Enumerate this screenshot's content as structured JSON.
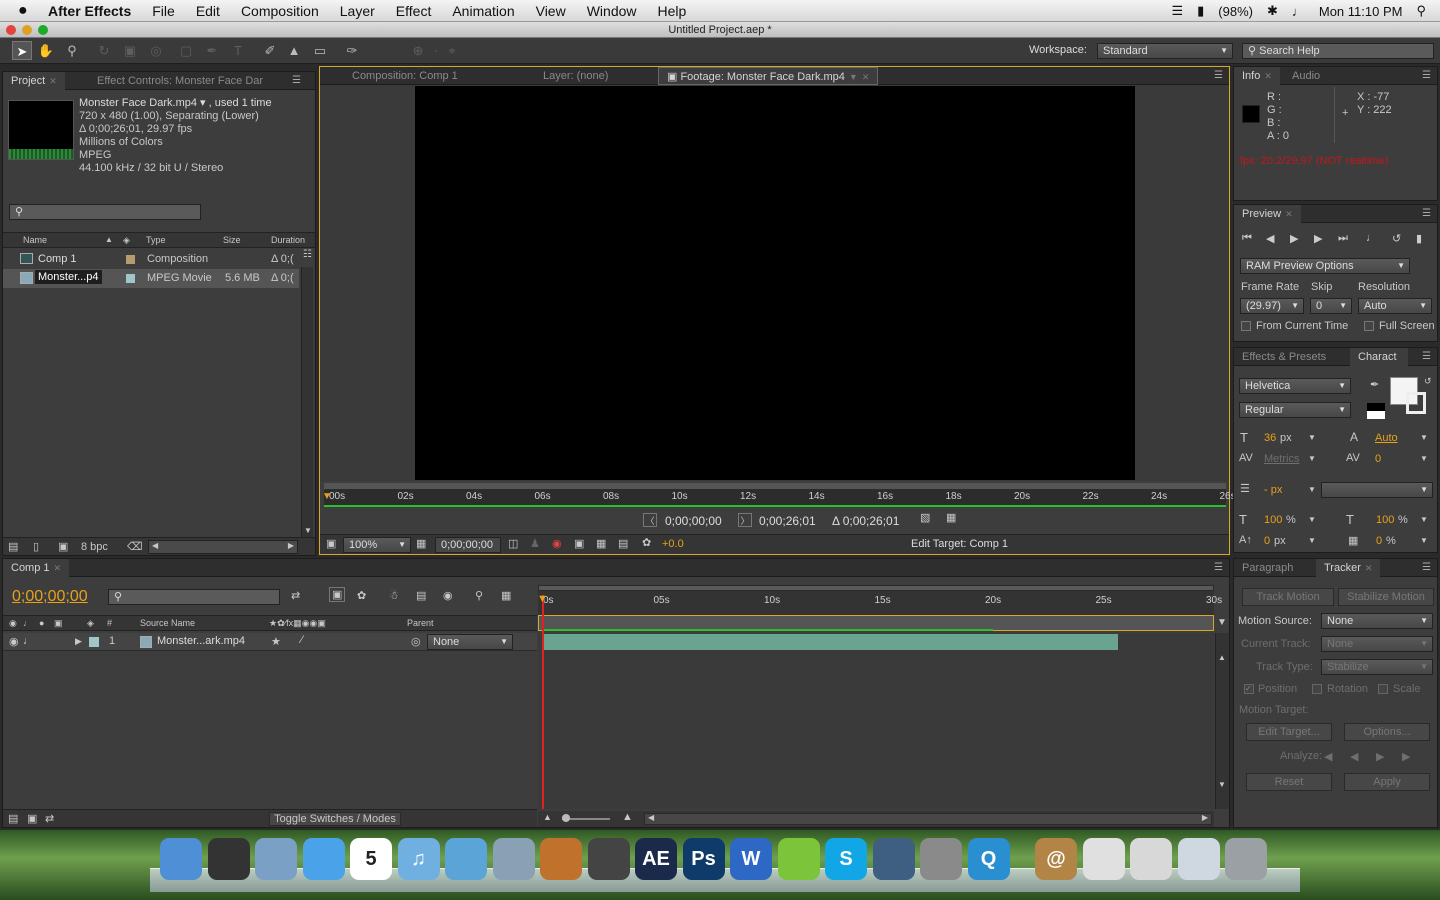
{
  "menubar": {
    "app": "After Effects",
    "items": [
      "File",
      "Edit",
      "Composition",
      "Layer",
      "Effect",
      "Animation",
      "View",
      "Window",
      "Help"
    ],
    "battery": "(98%)",
    "clock": "Mon 11:10 PM"
  },
  "window": {
    "title": "Untitled Project.aep *"
  },
  "toolbar": {
    "workspace_label": "Workspace:",
    "workspace_value": "Standard",
    "search_placeholder": "Search Help"
  },
  "project": {
    "tabs": [
      {
        "label": "Project"
      },
      {
        "label": "Effect Controls: Monster Face Dar"
      }
    ],
    "footage": {
      "name": "Monster Face Dark.mp4 ▾ , used 1 time",
      "line1": "720 x 480 (1.00), Separating (Lower)",
      "line2": "Δ 0;00;26;01, 29.97 fps",
      "line3": "Millions of Colors",
      "line4": "MPEG",
      "line5": "44.100 kHz / 32 bit U / Stereo"
    },
    "columns": {
      "name": "Name",
      "type": "Type",
      "size": "Size",
      "duration": "Duration"
    },
    "rows": [
      {
        "name": "Comp 1",
        "type": "Composition",
        "size": "",
        "duration": "Δ 0;(",
        "color": "#b59b6d"
      },
      {
        "name": "Monster...p4",
        "type": "MPEG Movie",
        "size": "5.6 MB",
        "duration": "Δ 0;(",
        "color": "#9fc7c7"
      }
    ],
    "bpc": "8 bpc"
  },
  "viewer": {
    "tabs": [
      {
        "label": "Composition: Comp 1"
      },
      {
        "label": "Layer: (none)"
      },
      {
        "label": "Footage: Monster Face Dark.mp4"
      }
    ],
    "ruler": [
      "00s",
      "02s",
      "04s",
      "06s",
      "08s",
      "10s",
      "12s",
      "14s",
      "16s",
      "18s",
      "20s",
      "22s",
      "24s",
      "26s"
    ],
    "in_time": "0;00;00;00",
    "out_time": "0;00;26;01",
    "duration_time": "Δ 0;00;26;01",
    "zoom": "100%",
    "current_time": "0;00;00;00",
    "offset": "+0.0",
    "edit_target": "Edit Target: Comp 1"
  },
  "info": {
    "tabs": [
      {
        "label": "Info"
      },
      {
        "label": "Audio"
      }
    ],
    "r": "R :",
    "g": "G :",
    "b": "B :",
    "a": "A : 0",
    "x": "X : -77",
    "y": "Y : 222",
    "fps": "fps: 20.2/29.97 (NOT realtime)"
  },
  "preview": {
    "tab": "Preview",
    "ram_options": "RAM Preview Options",
    "frame_rate_label": "Frame Rate",
    "skip_label": "Skip",
    "resolution_label": "Resolution",
    "frame_rate": "(29.97)",
    "skip": "0",
    "resolution": "Auto",
    "from_current": "From Current Time",
    "full_screen": "Full Screen"
  },
  "character": {
    "tabs": [
      {
        "label": "Effects & Presets"
      },
      {
        "label": "Charact"
      }
    ],
    "font": "Helvetica",
    "style": "Regular",
    "size": "36",
    "size_unit": "px",
    "leading": "Auto",
    "kerning": "Metrics",
    "tracking": "0",
    "stroke": "- px",
    "vscale": "100",
    "hscale": "100",
    "pct": "%",
    "baseline": "0",
    "baseline_unit": "px",
    "tsume": "0",
    "tsume_unit": "%"
  },
  "tracker": {
    "tabs": [
      {
        "label": "Paragraph"
      },
      {
        "label": "Tracker"
      }
    ],
    "track_motion": "Track Motion",
    "stabilize_motion": "Stabilize Motion",
    "motion_source_label": "Motion Source:",
    "motion_source": "None",
    "current_track_label": "Current Track:",
    "current_track": "None",
    "track_type_label": "Track Type:",
    "track_type": "Stabilize",
    "position": "Position",
    "rotation": "Rotation",
    "scale": "Scale",
    "motion_target_label": "Motion Target:",
    "edit_target": "Edit Target...",
    "options": "Options...",
    "analyze_label": "Analyze:",
    "reset": "Reset",
    "apply": "Apply"
  },
  "timeline": {
    "tab": "Comp 1",
    "current_time": "0;00;00;00",
    "source_name_header": "Source Name",
    "parent_header": "Parent",
    "ruler": [
      "0s",
      "05s",
      "10s",
      "15s",
      "20s",
      "25s",
      "30s"
    ],
    "layer": {
      "number": "1",
      "name": "Monster...ark.mp4",
      "parent": "None"
    },
    "toggle": "Toggle Switches / Modes"
  },
  "dock": {
    "icons": [
      {
        "name": "finder",
        "color": "#4f8fd6",
        "glyph": ""
      },
      {
        "name": "dashboard",
        "color": "#333333",
        "glyph": ""
      },
      {
        "name": "mail",
        "color": "#7ba0c6",
        "glyph": ""
      },
      {
        "name": "ichat",
        "color": "#4aa3e8",
        "glyph": ""
      },
      {
        "name": "ical",
        "color": "#ffffff",
        "glyph": "5"
      },
      {
        "name": "itunes",
        "color": "#6fb0e0",
        "glyph": "♫"
      },
      {
        "name": "safari",
        "color": "#5aa4d8",
        "glyph": ""
      },
      {
        "name": "iphoto",
        "color": "#8aa0b4",
        "glyph": ""
      },
      {
        "name": "image-capture",
        "color": "#c0722d",
        "glyph": ""
      },
      {
        "name": "final-cut",
        "color": "#444444",
        "glyph": ""
      },
      {
        "name": "after-effects",
        "color": "#1b2a4a",
        "glyph": "AE"
      },
      {
        "name": "photoshop",
        "color": "#0f3b6b",
        "glyph": "Ps"
      },
      {
        "name": "word",
        "color": "#2d68c4",
        "glyph": "W"
      },
      {
        "name": "limewire",
        "color": "#7cc43a",
        "glyph": ""
      },
      {
        "name": "skype",
        "color": "#11a7e6",
        "glyph": "S"
      },
      {
        "name": "expose",
        "color": "#3e5e82",
        "glyph": ""
      },
      {
        "name": "system-preferences",
        "color": "#8a8a8a",
        "glyph": ""
      },
      {
        "name": "quicktime",
        "color": "#2a8fd1",
        "glyph": "Q"
      },
      {
        "name": "address-book",
        "color": "#b28546",
        "glyph": "@"
      },
      {
        "name": "text-edit",
        "color": "#e0e0e0",
        "glyph": ""
      },
      {
        "name": "torrent",
        "color": "#d8d8d8",
        "glyph": ""
      },
      {
        "name": "preview-app",
        "color": "#cfd8e0",
        "glyph": ""
      },
      {
        "name": "trash",
        "color": "#9aa0a4",
        "glyph": ""
      }
    ]
  }
}
